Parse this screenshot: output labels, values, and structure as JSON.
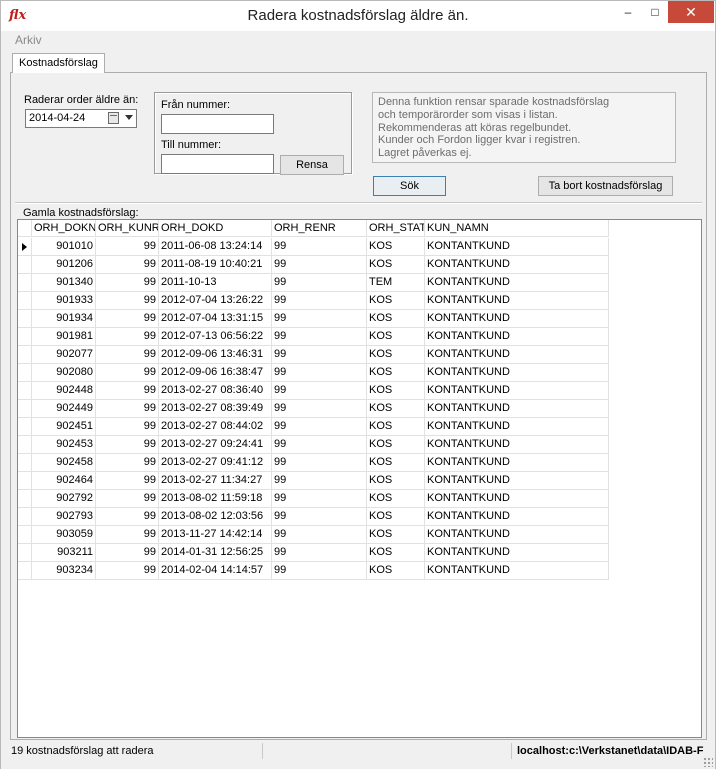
{
  "window": {
    "title": "Radera kostnadsförslag äldre än.",
    "icon_text": "flx",
    "min_glyph": "–",
    "max_glyph": "□",
    "close_glyph": "✕"
  },
  "menu": {
    "items": [
      "Arkiv"
    ]
  },
  "tabs": [
    {
      "label": "Kostnadsförslag"
    }
  ],
  "filters": {
    "older_than_label": "Raderar order äldre än:",
    "date_value": "2014-04-24",
    "from_label": "Från nummer:",
    "from_value": "",
    "to_label": "Till nummer:",
    "to_value": "",
    "rensa_label": "Rensa"
  },
  "info": {
    "lines": [
      "Denna funktion rensar sparade kostnadsförslag",
      "och temporärorder som visas i listan.",
      "Rekommenderas att köras regelbundet.",
      "Kunder och Fordon ligger kvar i registren.",
      "Lagret påverkas ej."
    ],
    "search_label": "Sök",
    "delete_label": "Ta bort kostnadsförslag"
  },
  "grid": {
    "label": "Gamla kostnadsförslag:",
    "columns": [
      "ORH_DOKN",
      "ORH_KUNR",
      "ORH_DOKD",
      "ORH_RENR",
      "ORH_STAT",
      "KUN_NAMN"
    ],
    "rows": [
      [
        "901010",
        "99",
        "2011-06-08 13:24:14",
        "99",
        "KOS",
        "KONTANTKUND"
      ],
      [
        "901206",
        "99",
        "2011-08-19 10:40:21",
        "99",
        "KOS",
        "KONTANTKUND"
      ],
      [
        "901340",
        "99",
        "2011-10-13",
        "99",
        "TEM",
        "KONTANTKUND"
      ],
      [
        "901933",
        "99",
        "2012-07-04 13:26:22",
        "99",
        "KOS",
        "KONTANTKUND"
      ],
      [
        "901934",
        "99",
        "2012-07-04 13:31:15",
        "99",
        "KOS",
        "KONTANTKUND"
      ],
      [
        "901981",
        "99",
        "2012-07-13 06:56:22",
        "99",
        "KOS",
        "KONTANTKUND"
      ],
      [
        "902077",
        "99",
        "2012-09-06 13:46:31",
        "99",
        "KOS",
        "KONTANTKUND"
      ],
      [
        "902080",
        "99",
        "2012-09-06 16:38:47",
        "99",
        "KOS",
        "KONTANTKUND"
      ],
      [
        "902448",
        "99",
        "2013-02-27 08:36:40",
        "99",
        "KOS",
        "KONTANTKUND"
      ],
      [
        "902449",
        "99",
        "2013-02-27 08:39:49",
        "99",
        "KOS",
        "KONTANTKUND"
      ],
      [
        "902451",
        "99",
        "2013-02-27 08:44:02",
        "99",
        "KOS",
        "KONTANTKUND"
      ],
      [
        "902453",
        "99",
        "2013-02-27 09:24:41",
        "99",
        "KOS",
        "KONTANTKUND"
      ],
      [
        "902458",
        "99",
        "2013-02-27 09:41:12",
        "99",
        "KOS",
        "KONTANTKUND"
      ],
      [
        "902464",
        "99",
        "2013-02-27 11:34:27",
        "99",
        "KOS",
        "KONTANTKUND"
      ],
      [
        "902792",
        "99",
        "2013-08-02 11:59:18",
        "99",
        "KOS",
        "KONTANTKUND"
      ],
      [
        "902793",
        "99",
        "2013-08-02 12:03:56",
        "99",
        "KOS",
        "KONTANTKUND"
      ],
      [
        "903059",
        "99",
        "2013-11-27 14:42:14",
        "99",
        "KOS",
        "KONTANTKUND"
      ],
      [
        "903211",
        "99",
        "2014-01-31 12:56:25",
        "99",
        "KOS",
        "KONTANTKUND"
      ],
      [
        "903234",
        "99",
        "2014-02-04 14:14:57",
        "99",
        "KOS",
        "KONTANTKUND"
      ]
    ]
  },
  "status": {
    "count_text": "19 kostnadsförslag att radera",
    "path_text": "localhost:c:\\Verkstanet\\data\\IDAB-F"
  }
}
